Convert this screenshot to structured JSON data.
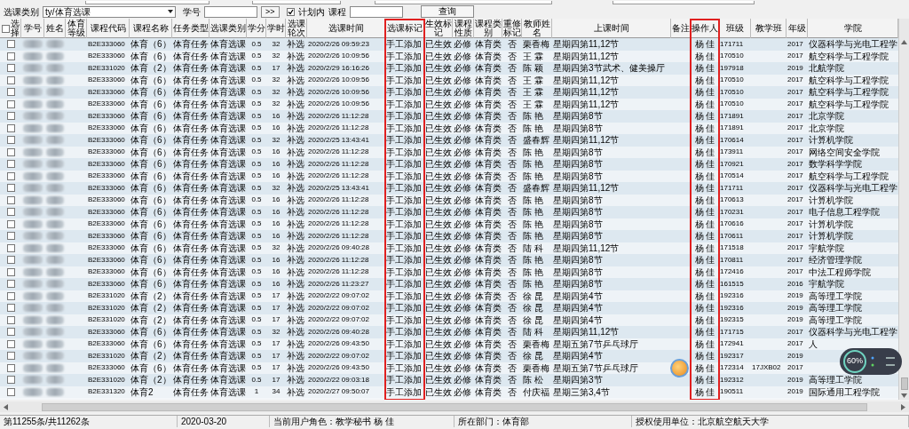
{
  "filter_bar": {
    "category_label": "选课类别",
    "category_value": "ty/体育选课",
    "student_id_label": "学号",
    "more_button": ">>",
    "in_plan": {
      "label": "计划内",
      "checked": true
    },
    "course_label": "课程",
    "query_button": "查询"
  },
  "table": {
    "select_all_checked": false,
    "columns": [
      {
        "label": "选择",
        "highlighted": false
      },
      {
        "label": "学号",
        "highlighted": false
      },
      {
        "label": "姓名",
        "highlighted": false
      },
      {
        "label": "体育等级",
        "highlighted": false
      },
      {
        "label": "课程代码",
        "highlighted": false
      },
      {
        "label": "课程名称",
        "highlighted": false
      },
      {
        "label": "任务类型",
        "highlighted": false
      },
      {
        "label": "选课类别",
        "highlighted": false
      },
      {
        "label": "学分",
        "highlighted": false
      },
      {
        "label": "学时",
        "highlighted": false
      },
      {
        "label": "选课轮次",
        "highlighted": false
      },
      {
        "label": "选课时间",
        "highlighted": false
      },
      {
        "label": "选课标记",
        "highlighted": true
      },
      {
        "label": "生效标记",
        "highlighted": false
      },
      {
        "label": "课程性质",
        "highlighted": false
      },
      {
        "label": "课程类别",
        "highlighted": false
      },
      {
        "label": "重修标记",
        "highlighted": false
      },
      {
        "label": "教师姓名",
        "highlighted": false
      },
      {
        "label": "上课时间",
        "highlighted": false
      },
      {
        "label": "备注",
        "highlighted": false
      },
      {
        "label": "操作人",
        "highlighted": true
      },
      {
        "label": "班级",
        "highlighted": false
      },
      {
        "label": "教学班",
        "highlighted": false
      },
      {
        "label": "年级",
        "highlighted": false
      },
      {
        "label": "学院",
        "highlighted": false
      }
    ],
    "rows": [
      {
        "checked": false,
        "code": "B2E333060",
        "course": "体育（6）",
        "task_type": "体育任务",
        "category": "体育选课",
        "credit": "0.5",
        "hours": "32",
        "round": "补选",
        "time": "2020/2/26 09:59:23",
        "mark": "手工添加",
        "effect": "已生效",
        "nature": "必修",
        "course_class": "体育类",
        "retake": "否",
        "teacher": "栗香梅",
        "schedule": "星期四第11,12节",
        "operator": "杨 佳",
        "class": "171711",
        "grade": "2017",
        "college": "仪器科学与光电工程学"
      },
      {
        "checked": false,
        "code": "B2E333060",
        "course": "体育（6）",
        "task_type": "体育任务",
        "category": "体育选课",
        "credit": "0.5",
        "hours": "32",
        "round": "补选",
        "time": "2020/2/26 10:09:56",
        "mark": "手工添加",
        "effect": "已生效",
        "nature": "必修",
        "course_class": "体育类",
        "retake": "否",
        "teacher": "王 霖",
        "schedule": "星期四第11,12节",
        "operator": "杨 佳",
        "class": "170510",
        "grade": "2017",
        "college": "航空科学与工程学院"
      },
      {
        "checked": false,
        "code": "B2E331020",
        "course": "体育（2）",
        "task_type": "体育任务",
        "category": "体育选课",
        "credit": "0.5",
        "hours": "17",
        "round": "补选",
        "time": "2020/2/29 16:16:26",
        "mark": "手工添加",
        "effect": "已生效",
        "nature": "必修",
        "course_class": "体育类",
        "retake": "否",
        "teacher": "陈 颖",
        "schedule": "星期四第3节武术、健美操厅",
        "operator": "杨 佳",
        "class": "197918",
        "grade": "2019",
        "college": "北航学院"
      },
      {
        "checked": false,
        "code": "B2E333060",
        "course": "体育（6）",
        "task_type": "体育任务",
        "category": "体育选课",
        "credit": "0.5",
        "hours": "32",
        "round": "补选",
        "time": "2020/2/26 10:09:56",
        "mark": "手工添加",
        "effect": "已生效",
        "nature": "必修",
        "course_class": "体育类",
        "retake": "否",
        "teacher": "王 霖",
        "schedule": "星期四第11,12节",
        "operator": "杨 佳",
        "class": "170510",
        "grade": "2017",
        "college": "航空科学与工程学院"
      },
      {
        "checked": false,
        "code": "B2E333060",
        "course": "体育（6）",
        "task_type": "体育任务",
        "category": "体育选课",
        "credit": "0.5",
        "hours": "32",
        "round": "补选",
        "time": "2020/2/26 10:09:56",
        "mark": "手工添加",
        "effect": "已生效",
        "nature": "必修",
        "course_class": "体育类",
        "retake": "否",
        "teacher": "王 霖",
        "schedule": "星期四第11,12节",
        "operator": "杨 佳",
        "class": "170510",
        "grade": "2017",
        "college": "航空科学与工程学院"
      },
      {
        "checked": false,
        "code": "B2E333060",
        "course": "体育（6）",
        "task_type": "体育任务",
        "category": "体育选课",
        "credit": "0.5",
        "hours": "32",
        "round": "补选",
        "time": "2020/2/26 10:09:56",
        "mark": "手工添加",
        "effect": "已生效",
        "nature": "必修",
        "course_class": "体育类",
        "retake": "否",
        "teacher": "王 霖",
        "schedule": "星期四第11,12节",
        "operator": "杨 佳",
        "class": "170510",
        "grade": "2017",
        "college": "航空科学与工程学院"
      },
      {
        "checked": false,
        "code": "B2E333060",
        "course": "体育（6）",
        "task_type": "体育任务",
        "category": "体育选课",
        "credit": "0.5",
        "hours": "16",
        "round": "补选",
        "time": "2020/2/26 11:12:28",
        "mark": "手工添加",
        "effect": "已生效",
        "nature": "必修",
        "course_class": "体育类",
        "retake": "否",
        "teacher": "陈 艳",
        "schedule": "星期四第8节",
        "operator": "杨 佳",
        "class": "171891",
        "grade": "2017",
        "college": "北京学院"
      },
      {
        "checked": false,
        "code": "B2E333060",
        "course": "体育（6）",
        "task_type": "体育任务",
        "category": "体育选课",
        "credit": "0.5",
        "hours": "16",
        "round": "补选",
        "time": "2020/2/26 11:12:28",
        "mark": "手工添加",
        "effect": "已生效",
        "nature": "必修",
        "course_class": "体育类",
        "retake": "否",
        "teacher": "陈 艳",
        "schedule": "星期四第8节",
        "operator": "杨 佳",
        "class": "171891",
        "grade": "2017",
        "college": "北京学院"
      },
      {
        "checked": false,
        "code": "B2E333060",
        "course": "体育（6）",
        "task_type": "体育任务",
        "category": "体育选课",
        "credit": "0.5",
        "hours": "32",
        "round": "补选",
        "time": "2020/2/25 13:43:41",
        "mark": "手工添加",
        "effect": "已生效",
        "nature": "必修",
        "course_class": "体育类",
        "retake": "否",
        "teacher": "盛春辉",
        "schedule": "星期四第11,12节",
        "operator": "杨 佳",
        "class": "170614",
        "grade": "2017",
        "college": "计算机学院"
      },
      {
        "checked": false,
        "code": "B2E333060",
        "course": "体育（6）",
        "task_type": "体育任务",
        "category": "体育选课",
        "credit": "0.5",
        "hours": "16",
        "round": "补选",
        "time": "2020/2/26 11:12:28",
        "mark": "手工添加",
        "effect": "已生效",
        "nature": "必修",
        "course_class": "体育类",
        "retake": "否",
        "teacher": "陈 艳",
        "schedule": "星期四第8节",
        "operator": "杨 佳",
        "class": "173911",
        "grade": "2017",
        "college": "网络空间安全学院"
      },
      {
        "checked": false,
        "code": "B2E333060",
        "course": "体育（6）",
        "task_type": "体育任务",
        "category": "体育选课",
        "credit": "0.5",
        "hours": "16",
        "round": "补选",
        "time": "2020/2/26 11:12:28",
        "mark": "手工添加",
        "effect": "已生效",
        "nature": "必修",
        "course_class": "体育类",
        "retake": "否",
        "teacher": "陈 艳",
        "schedule": "星期四第8节",
        "operator": "杨 佳",
        "class": "170921",
        "grade": "2017",
        "college": "数学科学学院"
      },
      {
        "checked": false,
        "code": "B2E333060",
        "course": "体育（6）",
        "task_type": "体育任务",
        "category": "体育选课",
        "credit": "0.5",
        "hours": "16",
        "round": "补选",
        "time": "2020/2/26 11:12:28",
        "mark": "手工添加",
        "effect": "已生效",
        "nature": "必修",
        "course_class": "体育类",
        "retake": "否",
        "teacher": "陈 艳",
        "schedule": "星期四第8节",
        "operator": "杨 佳",
        "class": "170514",
        "grade": "2017",
        "college": "航空科学与工程学院"
      },
      {
        "checked": false,
        "code": "B2E333060",
        "course": "体育（6）",
        "task_type": "体育任务",
        "category": "体育选课",
        "credit": "0.5",
        "hours": "32",
        "round": "补选",
        "time": "2020/2/25 13:43:41",
        "mark": "手工添加",
        "effect": "已生效",
        "nature": "必修",
        "course_class": "体育类",
        "retake": "否",
        "teacher": "盛春辉",
        "schedule": "星期四第11,12节",
        "operator": "杨 佳",
        "class": "171711",
        "grade": "2017",
        "college": "仪器科学与光电工程学"
      },
      {
        "checked": false,
        "code": "B2E333060",
        "course": "体育（6）",
        "task_type": "体育任务",
        "category": "体育选课",
        "credit": "0.5",
        "hours": "16",
        "round": "补选",
        "time": "2020/2/26 11:12:28",
        "mark": "手工添加",
        "effect": "已生效",
        "nature": "必修",
        "course_class": "体育类",
        "retake": "否",
        "teacher": "陈 艳",
        "schedule": "星期四第8节",
        "operator": "杨 佳",
        "class": "170613",
        "grade": "2017",
        "college": "计算机学院"
      },
      {
        "checked": false,
        "code": "B2E333060",
        "course": "体育（6）",
        "task_type": "体育任务",
        "category": "体育选课",
        "credit": "0.5",
        "hours": "16",
        "round": "补选",
        "time": "2020/2/26 11:12:28",
        "mark": "手工添加",
        "effect": "已生效",
        "nature": "必修",
        "course_class": "体育类",
        "retake": "否",
        "teacher": "陈 艳",
        "schedule": "星期四第8节",
        "operator": "杨 佳",
        "class": "170231",
        "grade": "2017",
        "college": "电子信息工程学院"
      },
      {
        "checked": false,
        "code": "B2E333060",
        "course": "体育（6）",
        "task_type": "体育任务",
        "category": "体育选课",
        "credit": "0.5",
        "hours": "16",
        "round": "补选",
        "time": "2020/2/26 11:12:28",
        "mark": "手工添加",
        "effect": "已生效",
        "nature": "必修",
        "course_class": "体育类",
        "retake": "否",
        "teacher": "陈 艳",
        "schedule": "星期四第8节",
        "operator": "杨 佳",
        "class": "170616",
        "grade": "2017",
        "college": "计算机学院"
      },
      {
        "checked": false,
        "code": "B2E333060",
        "course": "体育（6）",
        "task_type": "体育任务",
        "category": "体育选课",
        "credit": "0.5",
        "hours": "16",
        "round": "补选",
        "time": "2020/2/26 11:12:28",
        "mark": "手工添加",
        "effect": "已生效",
        "nature": "必修",
        "course_class": "体育类",
        "retake": "否",
        "teacher": "陈 艳",
        "schedule": "星期四第8节",
        "operator": "杨 佳",
        "class": "170611",
        "grade": "2017",
        "college": "计算机学院"
      },
      {
        "checked": false,
        "code": "B2E333060",
        "course": "体育（6）",
        "task_type": "体育任务",
        "category": "体育选课",
        "credit": "0.5",
        "hours": "32",
        "round": "补选",
        "time": "2020/2/26 09:40:28",
        "mark": "手工添加",
        "effect": "已生效",
        "nature": "必修",
        "course_class": "体育类",
        "retake": "否",
        "teacher": "陆 科",
        "schedule": "星期四第11,12节",
        "operator": "杨 佳",
        "class": "171518",
        "grade": "2017",
        "college": "宇航学院"
      },
      {
        "checked": false,
        "code": "B2E333060",
        "course": "体育（6）",
        "task_type": "体育任务",
        "category": "体育选课",
        "credit": "0.5",
        "hours": "16",
        "round": "补选",
        "time": "2020/2/26 11:12:28",
        "mark": "手工添加",
        "effect": "已生效",
        "nature": "必修",
        "course_class": "体育类",
        "retake": "否",
        "teacher": "陈 艳",
        "schedule": "星期四第8节",
        "operator": "杨 佳",
        "class": "170811",
        "grade": "2017",
        "college": "经济管理学院"
      },
      {
        "checked": false,
        "code": "B2E333060",
        "course": "体育（6）",
        "task_type": "体育任务",
        "category": "体育选课",
        "credit": "0.5",
        "hours": "16",
        "round": "补选",
        "time": "2020/2/26 11:12:28",
        "mark": "手工添加",
        "effect": "已生效",
        "nature": "必修",
        "course_class": "体育类",
        "retake": "否",
        "teacher": "陈 艳",
        "schedule": "星期四第8节",
        "operator": "杨 佳",
        "class": "172416",
        "grade": "2017",
        "college": "中法工程师学院"
      },
      {
        "checked": false,
        "code": "B2E333060",
        "course": "体育（6）",
        "task_type": "体育任务",
        "category": "体育选课",
        "credit": "0.5",
        "hours": "16",
        "round": "补选",
        "time": "2020/2/26 11:23:27",
        "mark": "手工添加",
        "effect": "已生效",
        "nature": "必修",
        "course_class": "体育类",
        "retake": "否",
        "teacher": "陈 艳",
        "schedule": "星期四第8节",
        "operator": "杨 佳",
        "class": "161515",
        "grade": "2016",
        "college": "宇航学院"
      },
      {
        "checked": false,
        "code": "B2E331020",
        "course": "体育（2）",
        "task_type": "体育任务",
        "category": "体育选课",
        "credit": "0.5",
        "hours": "17",
        "round": "补选",
        "time": "2020/2/22 09:07:02",
        "mark": "手工添加",
        "effect": "已生效",
        "nature": "必修",
        "course_class": "体育类",
        "retake": "否",
        "teacher": "徐 昆",
        "schedule": "星期四第4节",
        "operator": "杨 佳",
        "class": "192316",
        "grade": "2019",
        "college": "高等理工学院"
      },
      {
        "checked": false,
        "code": "B2E331020",
        "course": "体育（2）",
        "task_type": "体育任务",
        "category": "体育选课",
        "credit": "0.5",
        "hours": "17",
        "round": "补选",
        "time": "2020/2/22 09:07:02",
        "mark": "手工添加",
        "effect": "已生效",
        "nature": "必修",
        "course_class": "体育类",
        "retake": "否",
        "teacher": "徐 昆",
        "schedule": "星期四第4节",
        "operator": "杨 佳",
        "class": "192316",
        "grade": "2019",
        "college": "高等理工学院"
      },
      {
        "checked": false,
        "code": "B2E331020",
        "course": "体育（2）",
        "task_type": "体育任务",
        "category": "体育选课",
        "credit": "0.5",
        "hours": "17",
        "round": "补选",
        "time": "2020/2/22 09:07:02",
        "mark": "手工添加",
        "effect": "已生效",
        "nature": "必修",
        "course_class": "体育类",
        "retake": "否",
        "teacher": "徐 昆",
        "schedule": "星期四第4节",
        "operator": "杨 佳",
        "class": "192315",
        "grade": "2019",
        "college": "高等理工学院"
      },
      {
        "checked": false,
        "code": "B2E333060",
        "course": "体育（6）",
        "task_type": "体育任务",
        "category": "体育选课",
        "credit": "0.5",
        "hours": "32",
        "round": "补选",
        "time": "2020/2/26 09:40:28",
        "mark": "手工添加",
        "effect": "已生效",
        "nature": "必修",
        "course_class": "体育类",
        "retake": "否",
        "teacher": "陆 科",
        "schedule": "星期四第11,12节",
        "operator": "杨 佳",
        "class": "171715",
        "grade": "2017",
        "college": "仪器科学与光电工程学"
      },
      {
        "checked": false,
        "code": "B2E333060",
        "course": "体育（6）",
        "task_type": "体育任务",
        "category": "体育选课",
        "credit": "0.5",
        "hours": "17",
        "round": "补选",
        "time": "2020/2/26 09:43:50",
        "mark": "手工添加",
        "effect": "已生效",
        "nature": "必修",
        "course_class": "体育类",
        "retake": "否",
        "teacher": "栗香梅",
        "schedule": "星期五第7节乒乓球厅",
        "operator": "杨 佳",
        "class": "172941",
        "grade": "2017",
        "college": "人"
      },
      {
        "checked": false,
        "code": "B2E331020",
        "course": "体育（2）",
        "task_type": "体育任务",
        "category": "体育选课",
        "credit": "0.5",
        "hours": "17",
        "round": "补选",
        "time": "2020/2/22 09:07:02",
        "mark": "手工添加",
        "effect": "已生效",
        "nature": "必修",
        "course_class": "体育类",
        "retake": "否",
        "teacher": "徐 昆",
        "schedule": "星期四第4节",
        "operator": "杨 佳",
        "class": "192317",
        "grade": "2019"
      },
      {
        "checked": false,
        "code": "B2E333060",
        "course": "体育（6）",
        "task_type": "体育任务",
        "category": "体育选课",
        "credit": "0.5",
        "hours": "17",
        "round": "补选",
        "time": "2020/2/26 09:43:50",
        "mark": "手工添加",
        "effect": "已生效",
        "nature": "必修",
        "course_class": "体育类",
        "retake": "否",
        "teacher": "栗香梅",
        "schedule": "星期五第7节乒乓球厅",
        "operator": "杨 佳",
        "class": "172314",
        "teaching_class": "17JXB02",
        "grade": "2017"
      },
      {
        "checked": false,
        "code": "B2E331020",
        "course": "体育（2）",
        "task_type": "体育任务",
        "category": "体育选课",
        "credit": "0.5",
        "hours": "17",
        "round": "补选",
        "time": "2020/2/22 09:03:18",
        "mark": "手工添加",
        "effect": "已生效",
        "nature": "必修",
        "course_class": "体育类",
        "retake": "否",
        "teacher": "陈 松",
        "schedule": "星期四第3节",
        "operator": "杨 佳",
        "class": "192312",
        "grade": "2019",
        "college": "高等理工学院"
      },
      {
        "checked": false,
        "code": "B2E331320",
        "course": "体育2",
        "task_type": "体育任务",
        "category": "体育选课",
        "credit": "1",
        "hours": "34",
        "round": "补选",
        "time": "2020/2/27 09:50:07",
        "mark": "手工添加",
        "effect": "已生效",
        "nature": "必修",
        "course_class": "体育类",
        "retake": "否",
        "teacher": "付庆福",
        "schedule": "星期三第3,4节",
        "operator": "杨 佳",
        "class": "190511",
        "grade": "2019",
        "college": "国际通用工程学院"
      }
    ]
  },
  "speed_widget": {
    "reading": "60%"
  },
  "status_bar": [
    "第11255条/共11262条",
    "2020-03-20",
    "当前用户角色：教学秘书  杨  佳",
    "所在部门：体育部",
    "授权使用单位：北京航空航天大学"
  ]
}
